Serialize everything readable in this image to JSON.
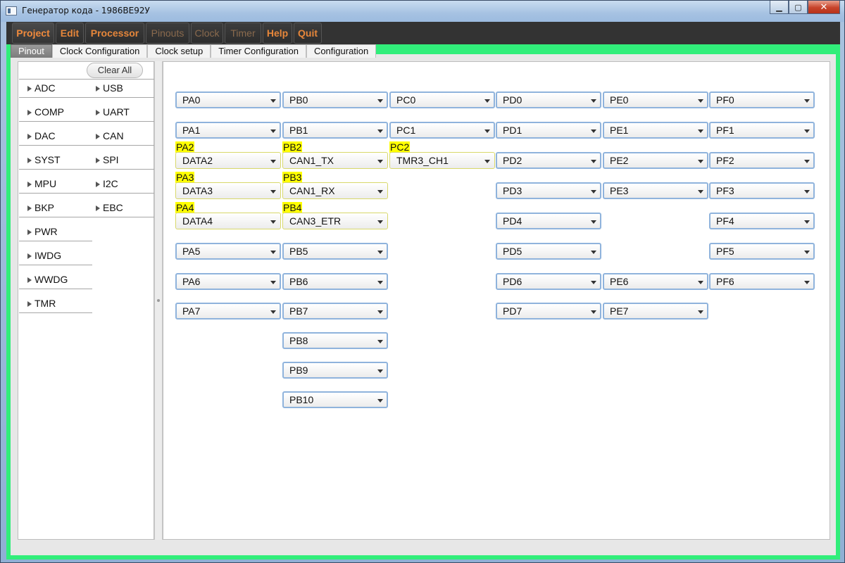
{
  "window": {
    "title": "Генератор кода - 1986ВЕ92У",
    "controls": {
      "minimize": "▁",
      "maximize": "▢",
      "close": "✕"
    }
  },
  "menu": {
    "items": [
      "Project",
      "Edit",
      "Processor",
      "Pinouts",
      "Clock",
      "Timer",
      "Help",
      "Quit"
    ]
  },
  "tabs": [
    "Pinout",
    "Clock Configuration",
    "Clock setup",
    "Timer Configuration",
    "Configuration"
  ],
  "left_panel": {
    "clear_all": "Clear All",
    "col1": [
      "ADC",
      "COMP",
      "DAC",
      "SYST",
      "MPU",
      "BKP",
      "PWR",
      "IWDG",
      "WWDG",
      "TMR"
    ],
    "col2": [
      "USB",
      "UART",
      "CAN",
      "SPI",
      "I2C",
      "EBC"
    ]
  },
  "pins": {
    "colA": [
      {
        "value": "PA0"
      },
      {
        "value": "PA1"
      },
      {
        "label": "PA2",
        "value": "DATA2"
      },
      {
        "label": "PA3",
        "value": "DATA3"
      },
      {
        "label": "PA4",
        "value": "DATA4"
      },
      {
        "value": "PA5"
      },
      {
        "value": "PA6"
      },
      {
        "value": "PA7"
      }
    ],
    "colB": [
      {
        "value": "PB0"
      },
      {
        "value": "PB1"
      },
      {
        "label": "PB2",
        "value": "CAN1_TX"
      },
      {
        "label": "PB3",
        "value": "CAN1_RX"
      },
      {
        "label": "PB4",
        "value": "CAN3_ETR"
      },
      {
        "value": "PB5"
      },
      {
        "value": "PB6"
      },
      {
        "value": "PB7"
      },
      {
        "value": "PB8"
      },
      {
        "value": "PB9"
      },
      {
        "value": "PB10"
      }
    ],
    "colC": [
      {
        "value": "PC0"
      },
      {
        "value": "PC1"
      },
      {
        "label": "PC2",
        "value": "TMR3_CH1"
      }
    ],
    "colD": [
      {
        "value": "PD0"
      },
      {
        "value": "PD1"
      },
      {
        "value": "PD2"
      },
      {
        "value": "PD3"
      },
      {
        "value": "PD4"
      },
      {
        "value": "PD5"
      },
      {
        "value": "PD6"
      },
      {
        "value": "PD7"
      }
    ],
    "colE": [
      {
        "value": "PE0"
      },
      {
        "value": "PE1"
      },
      {
        "value": "PE2"
      },
      {
        "value": "PE3"
      },
      {
        "value": "PE6"
      },
      {
        "value": "PE7"
      }
    ],
    "colF": [
      {
        "value": "PF0"
      },
      {
        "value": "PF1"
      },
      {
        "value": "PF2"
      },
      {
        "value": "PF3"
      },
      {
        "value": "PF4"
      },
      {
        "value": "PF5"
      },
      {
        "value": "PF6"
      }
    ]
  }
}
